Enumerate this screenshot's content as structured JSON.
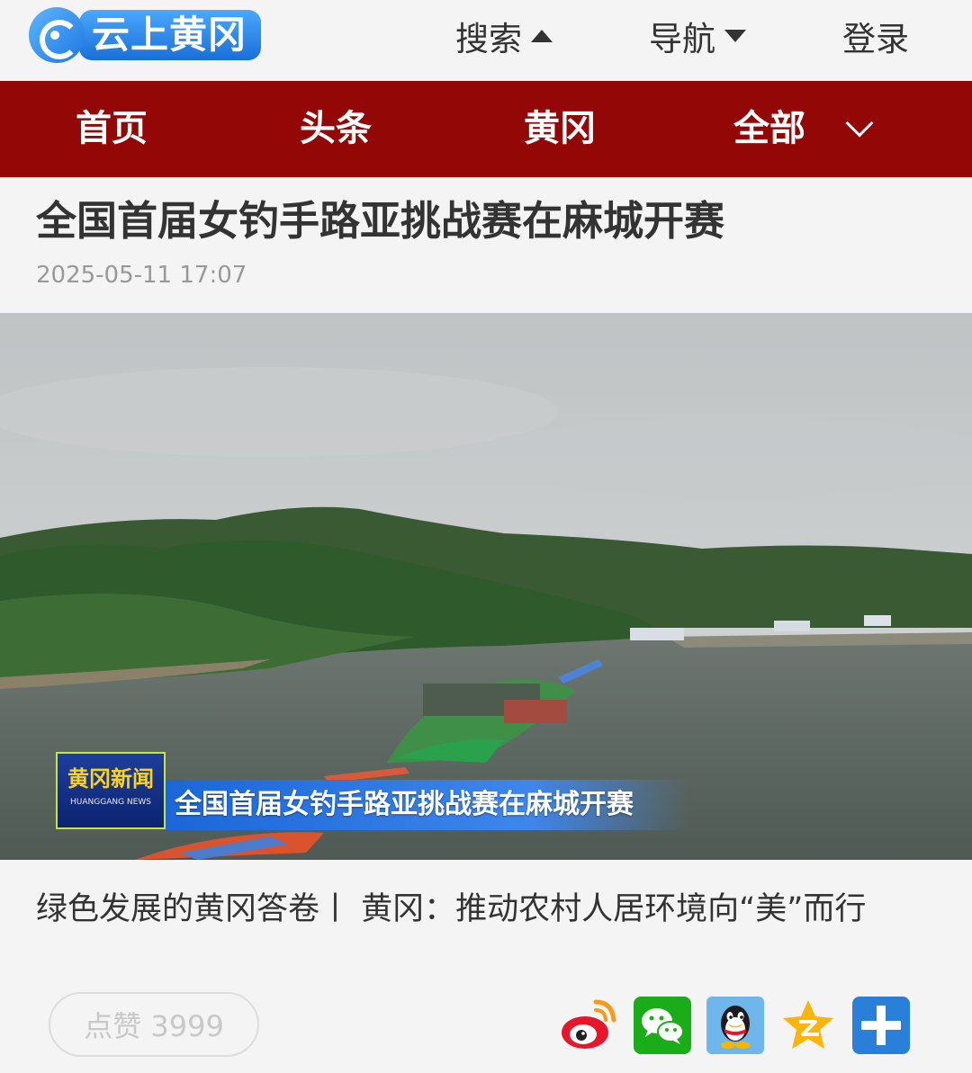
{
  "header": {
    "logo_text": "云上黄冈",
    "search_label": "搜索",
    "nav_menu_label": "导航",
    "login_label": "登录"
  },
  "nav": {
    "items": [
      {
        "label": "首页"
      },
      {
        "label": "头条"
      },
      {
        "label": "黄冈"
      },
      {
        "label": "全部"
      }
    ]
  },
  "article": {
    "title": "全国首届女钓手路亚挑战赛在麻城开赛",
    "date": "2025-05-11 17:07",
    "image": {
      "news_logo_main": "黄冈新闻",
      "news_logo_sub": "HUANGGANG NEWS",
      "caption": "全国首届女钓手路亚挑战赛在麻城开赛"
    },
    "related_link": "绿色发展的黄冈答卷丨 黄冈：推动农村人居环境向“美”而行"
  },
  "actions": {
    "like_label": "点赞 3999"
  },
  "share": [
    {
      "icon": "weibo-icon"
    },
    {
      "icon": "wechat-icon"
    },
    {
      "icon": "qq-icon"
    },
    {
      "icon": "qzone-icon"
    },
    {
      "icon": "more-share-icon"
    }
  ],
  "colors": {
    "nav_bg": "#940707",
    "page_bg": "#f4f4f4",
    "logo_blue": "#1f77e0"
  }
}
